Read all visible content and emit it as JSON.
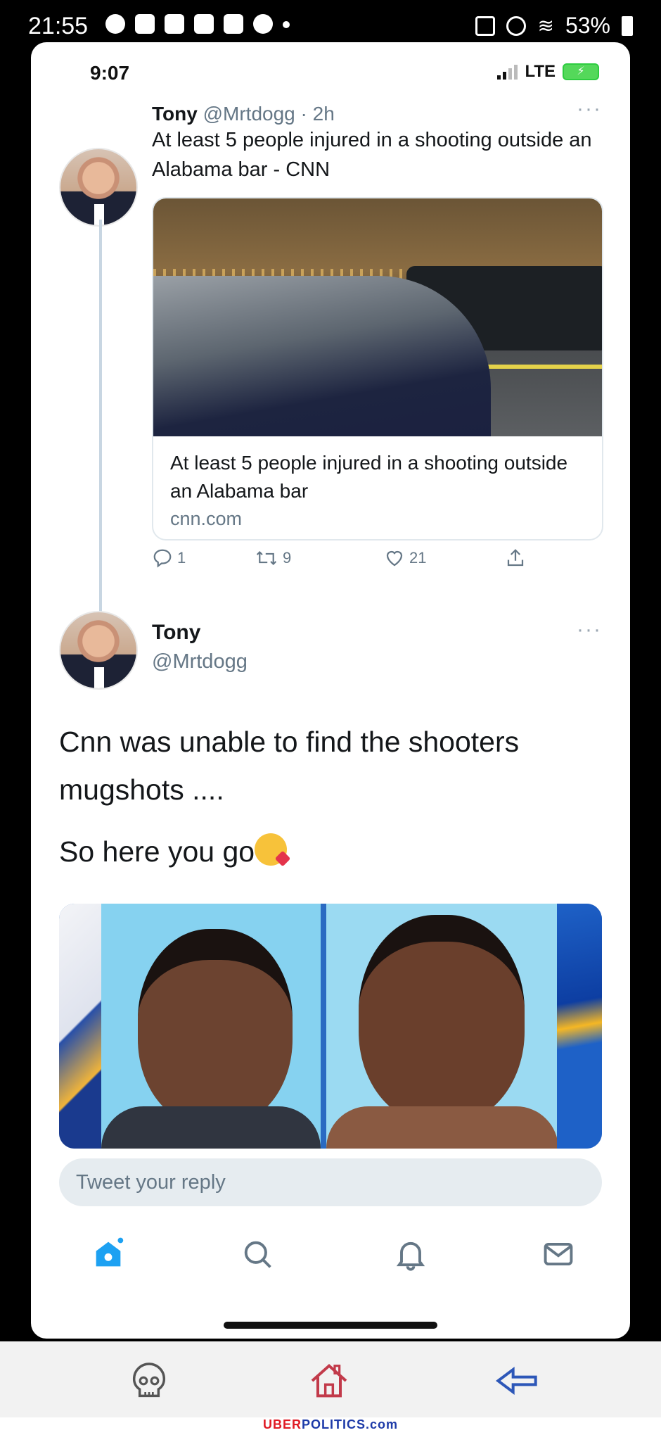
{
  "outer_status": {
    "time": "21:55",
    "battery": "53%"
  },
  "ios_status": {
    "time": "9:07",
    "network": "LTE"
  },
  "tweet1": {
    "header_name": "Tony",
    "header_meta": "@Mrtdogg · 2h",
    "text": "At least 5 people injured in a shooting outside an Alabama bar - CNN",
    "more": "···",
    "card": {
      "title": "At least 5 people injured in a shooting outside an Alabama bar",
      "domain": "cnn.com"
    },
    "actions": {
      "replies": "1",
      "retweets": "9",
      "likes": "21"
    }
  },
  "tweet2": {
    "name": "Tony",
    "handle": "@Mrtdogg",
    "more": "···",
    "body1": "Cnn was unable to find the shooters mugshots ....",
    "body2": "So here you go"
  },
  "reply": {
    "placeholder": "Tweet your reply"
  },
  "tabs": [
    "home-icon",
    "search-icon",
    "notifications-icon",
    "messages-icon"
  ],
  "android_nav": [
    "skull-icon",
    "home-outline-icon",
    "back-arrow-icon"
  ],
  "footer": {
    "brand_red": "UBER",
    "brand_blue": "POLITICS.com"
  },
  "colors": {
    "twitter_blue": "#1da1f2",
    "text_primary": "#14171a",
    "text_secondary": "#657786"
  }
}
